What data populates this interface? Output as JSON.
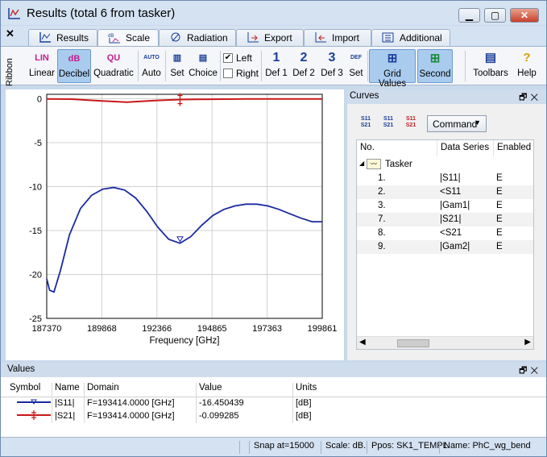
{
  "window": {
    "title": "Results (total 6 from tasker)"
  },
  "ribbon": {
    "label": "Ribbon",
    "tabs": [
      {
        "label": "Results",
        "icon": "results-icon"
      },
      {
        "label": "Scale",
        "icon": "scale-icon",
        "active": true
      },
      {
        "label": "Radiation",
        "icon": "radiation-icon"
      },
      {
        "label": "Export",
        "icon": "export-icon"
      },
      {
        "label": "Import",
        "icon": "import-icon"
      },
      {
        "label": "Additional",
        "icon": "additional-icon"
      }
    ],
    "buttons": {
      "linear": {
        "label": "Linear",
        "glyph": "LIN"
      },
      "decibel": {
        "label": "Decibel",
        "glyph": "dB"
      },
      "quadratic": {
        "label": "Quadratic",
        "glyph": "QU"
      },
      "auto": {
        "label": "Auto",
        "glyph": "AUTO"
      },
      "set": {
        "label": "Set"
      },
      "choice": {
        "label": "Choice"
      },
      "left": {
        "label": "Left",
        "checked": true
      },
      "right": {
        "label": "Right",
        "checked": false
      },
      "def1": {
        "label": "Def 1",
        "glyph": "1"
      },
      "def2": {
        "label": "Def 2",
        "glyph": "2"
      },
      "def3": {
        "label": "Def 3",
        "glyph": "3"
      },
      "set2": {
        "label": "Set",
        "glyph": "DEF"
      },
      "grid_values": {
        "label": "Grid Values"
      },
      "second": {
        "label": "Second"
      },
      "toolbars": {
        "label": "Toolbars"
      },
      "help": {
        "label": "Help"
      }
    }
  },
  "chart_data": {
    "type": "line",
    "xlabel": "Frequency [GHz]",
    "ylabel": "",
    "x_ticks": [
      "187370",
      "189868",
      "192366",
      "194865",
      "197363",
      "199861"
    ],
    "y_ticks": [
      "0",
      "-5",
      "-10",
      "-15",
      "-20",
      "-25"
    ],
    "xlim": [
      187370,
      199861
    ],
    "ylim": [
      -25,
      0.5
    ],
    "series": [
      {
        "name": "|S11|",
        "color": "#1a2aa0",
        "x": [
          187370,
          187500,
          187700,
          188000,
          188400,
          188900,
          189400,
          189900,
          190400,
          190900,
          191400,
          191900,
          192400,
          192900,
          193414,
          193900,
          194400,
          194900,
          195400,
          195900,
          196400,
          196900,
          197400,
          197900,
          198400,
          198900,
          199400,
          199861
        ],
        "y": [
          -20.5,
          -21.8,
          -22.0,
          -19.5,
          -15.5,
          -12.5,
          -11.0,
          -10.3,
          -10.1,
          -10.4,
          -11.3,
          -12.8,
          -14.6,
          -16.0,
          -16.45,
          -15.7,
          -14.4,
          -13.3,
          -12.6,
          -12.2,
          -12.0,
          -12.0,
          -12.2,
          -12.6,
          -13.1,
          -13.6,
          -14.0,
          -14.0
        ]
      },
      {
        "name": "|S21|",
        "color": "#c81818",
        "x": [
          187370,
          188500,
          189868,
          191000,
          192366,
          193414,
          194865,
          196500,
          197363,
          199861
        ],
        "y": [
          -0.02,
          -0.05,
          -0.25,
          -0.4,
          -0.2,
          -0.099,
          -0.06,
          -0.03,
          -0.02,
          -0.02
        ]
      }
    ],
    "cursor_x": 193414
  },
  "curves": {
    "title": "Curves",
    "command_label": "Command",
    "toolbar": [
      {
        "icon": "s11-s21-icon",
        "text": "S11 S21"
      },
      {
        "icon": "s11-s21-icon",
        "text": "S11 S21"
      },
      {
        "icon": "s11-s21-icon",
        "text": "S11 S21"
      }
    ],
    "columns": [
      "No.",
      "Data Series",
      "Enabled"
    ],
    "group": "Tasker",
    "rows": [
      {
        "no": "1.",
        "series": "|S11|",
        "enabled": "E"
      },
      {
        "no": "2.",
        "series": "<S11",
        "enabled": "E"
      },
      {
        "no": "3.",
        "series": "|Gam1|",
        "enabled": "E"
      },
      {
        "no": "7.",
        "series": "|S21|",
        "enabled": "E"
      },
      {
        "no": "8.",
        "series": "<S21",
        "enabled": "E"
      },
      {
        "no": "9.",
        "series": "|Gam2|",
        "enabled": "E"
      }
    ]
  },
  "values": {
    "title": "Values",
    "columns": [
      "Symbol",
      "Name",
      "Domain",
      "Value",
      "Units"
    ],
    "rows": [
      {
        "name": "|S11|",
        "domain": "F=193414.0000 [GHz]",
        "value": "-16.450439",
        "units": "[dB]",
        "color": "#1a2aa0"
      },
      {
        "name": "|S21|",
        "domain": "F=193414.0000 [GHz]",
        "value": "-0.099285",
        "units": "[dB]",
        "color": "#c81818"
      }
    ]
  },
  "status": {
    "snap": "Snap at=15000",
    "scale": "Scale: dB.",
    "ppos": "Ppos: SK1_TEMPL",
    "name": "Name: PhC_wg_bend"
  }
}
